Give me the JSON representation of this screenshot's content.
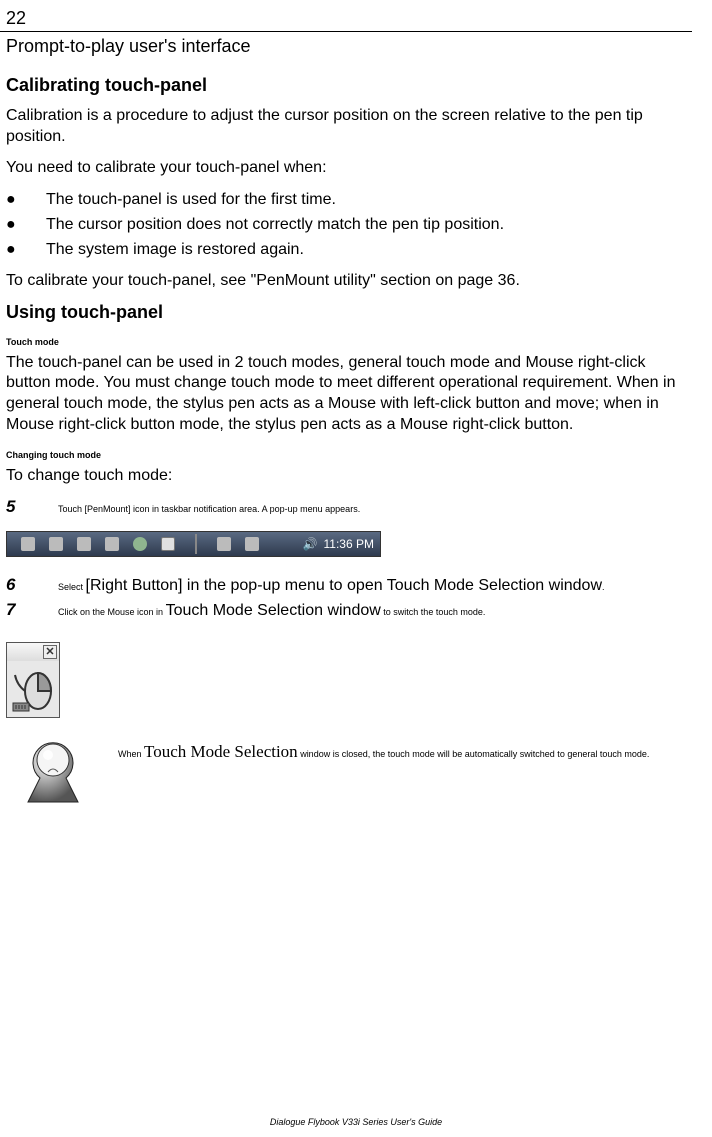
{
  "page_number": "22",
  "chapter_title": "Prompt-to-play user's interface",
  "section1_title": "Calibrating touch-panel",
  "section1_p1": "Calibration is a procedure to adjust the cursor position on the screen relative to the pen tip position.",
  "section1_p2": "You need to calibrate your touch-panel when:",
  "bullets": [
    "The touch-panel is used for the first time.",
    "The cursor position does not correctly match the pen tip position.",
    "The system image is restored again."
  ],
  "section1_p3": "To calibrate your touch-panel, see \"PenMount utility\" section on page 36.",
  "section2_title": "Using touch-panel",
  "sub_touch_mode": "Touch mode",
  "touch_mode_para": "The touch-panel can be used in 2 touch modes, general touch mode and Mouse right-click button mode. You must change touch mode to meet different operational requirement. When in general touch mode, the stylus pen acts as a Mouse with left-click button and move; when in Mouse right-click button mode, the stylus pen acts as a Mouse right-click button.",
  "sub_changing": "Changing touch mode",
  "changing_intro": "To change touch mode:",
  "step5_num": "5",
  "step5_text": "Touch [PenMount] icon in taskbar notification area. A pop-up menu appears.",
  "taskbar_time": "11:36 PM",
  "step6_num": "6",
  "step6_pre": "Select ",
  "step6_big": "[Right Button] in the pop-up menu to open Touch Mode Selection window",
  "step6_post": ".",
  "step7_num": "7",
  "step7_pre": "Click on the Mouse icon in ",
  "step7_big": "Touch Mode Selection window",
  "step7_post": " to switch the touch mode.",
  "note_pre": "When ",
  "note_big": "Touch Mode Selection",
  "note_post": " window is closed, the touch mode will be automatically switched to general touch mode.",
  "footer": "Dialogue Flybook V33i Series User's Guide"
}
